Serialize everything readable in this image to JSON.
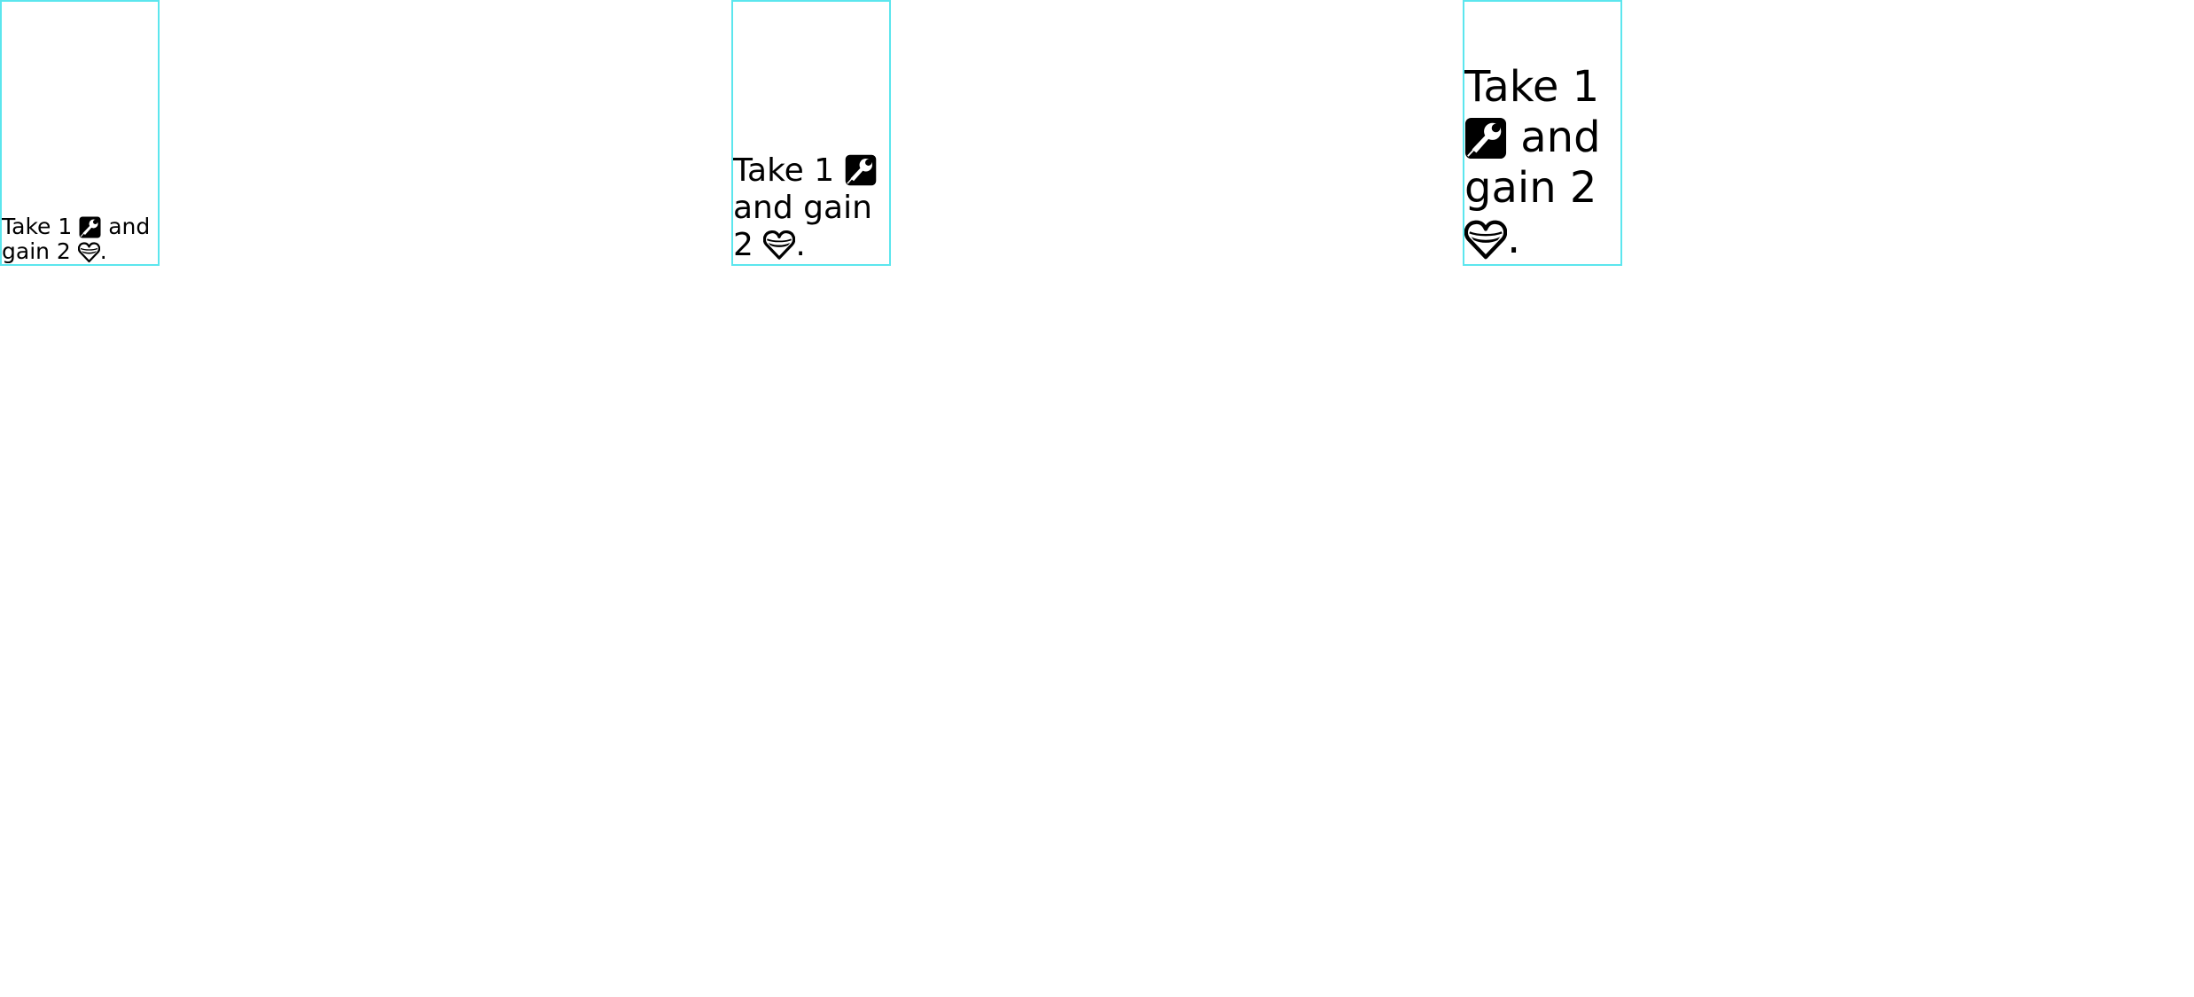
{
  "cards": [
    {
      "parts": {
        "p1": "Take 1",
        "p2": "and gain 2",
        "p3": "."
      }
    },
    {
      "parts": {
        "p1": "Take 1",
        "p2": "and gain 2",
        "p3": "."
      }
    },
    {
      "parts": {
        "p1": "Take 1",
        "p2": "and gain 2",
        "p3": "."
      }
    }
  ],
  "icons": {
    "first": "wrench-icon",
    "second": "heart-icon"
  },
  "colors": {
    "border": "#5ce6ee",
    "text": "#000000",
    "background": "#ffffff"
  }
}
